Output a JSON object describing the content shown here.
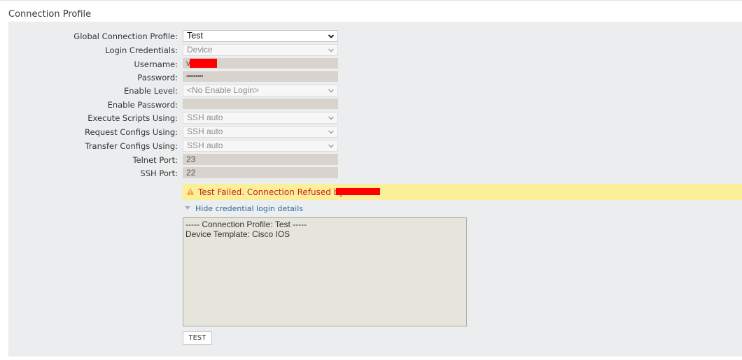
{
  "section": {
    "title": "Connection Profile"
  },
  "form": {
    "global_profile": {
      "label": "Global Connection Profile:",
      "value": "Test"
    },
    "login_credentials": {
      "label": "Login Credentials:",
      "value": "Device"
    },
    "username": {
      "label": "Username:",
      "value": "v"
    },
    "password": {
      "label": "Password:",
      "value": "•••••••••"
    },
    "enable_level": {
      "label": "Enable Level:",
      "value": "<No Enable Login>"
    },
    "enable_password": {
      "label": "Enable Password:",
      "value": ""
    },
    "execute_scripts": {
      "label": "Execute Scripts Using:",
      "value": "SSH auto"
    },
    "request_configs": {
      "label": "Request Configs Using:",
      "value": "SSH auto"
    },
    "transfer_configs": {
      "label": "Transfer Configs Using:",
      "value": "SSH auto"
    },
    "telnet_port": {
      "label": "Telnet Port:",
      "value": "23"
    },
    "ssh_port": {
      "label": "SSH Port:",
      "value": "22"
    }
  },
  "alert": {
    "text": "Test Failed. Connection Refused by",
    "icon": "warning-icon",
    "color": "#cc1f1f",
    "background": "#fbef9a"
  },
  "details_toggle": {
    "label": "Hide credential login details"
  },
  "log": {
    "lines": [
      "----- Connection Profile: Test -----",
      "Device Template: Cisco IOS"
    ]
  },
  "test_button": {
    "label": "TEST"
  }
}
